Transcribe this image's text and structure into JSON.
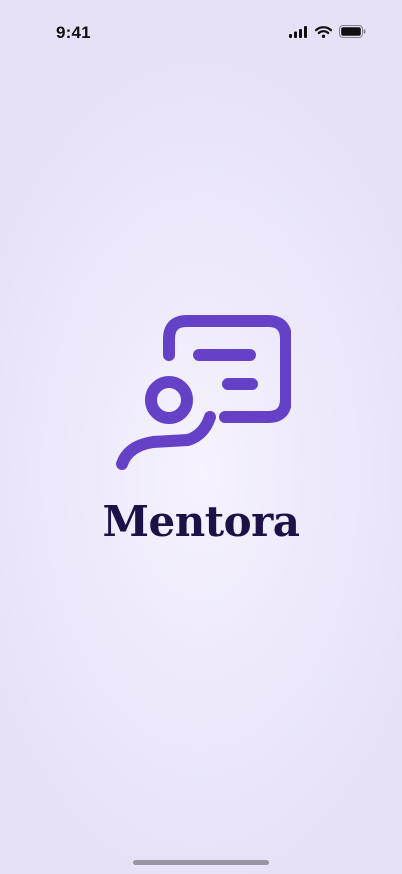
{
  "status_bar": {
    "time": "9:41",
    "icons": [
      "cellular-signal-icon",
      "wifi-icon",
      "battery-icon"
    ]
  },
  "splash": {
    "app_name": "Mentora",
    "logo_icon": "mentor-chat-logo-icon"
  },
  "colors": {
    "brand_purple": "#6541c8",
    "title_ink": "#1d1147",
    "background": "#eeeafb"
  }
}
